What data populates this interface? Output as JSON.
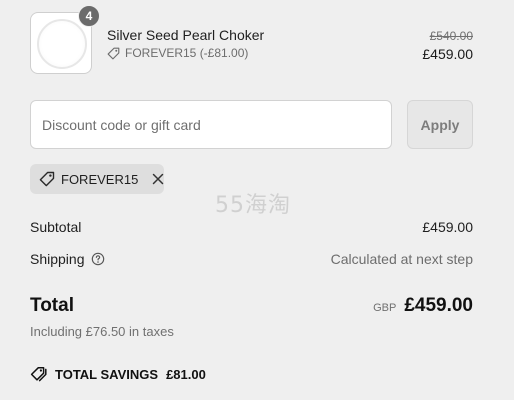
{
  "product": {
    "quantity": "4",
    "name": "Silver Seed Pearl Choker",
    "discount_label": "FOREVER15 (-£81.00)",
    "original_price": "£540.00",
    "final_price": "£459.00"
  },
  "discount": {
    "placeholder": "Discount code or gift card",
    "apply_label": "Apply",
    "applied_code": "FOREVER15"
  },
  "watermark": "55海淘",
  "summary": {
    "subtotal_label": "Subtotal",
    "subtotal_value": "£459.00",
    "shipping_label": "Shipping",
    "shipping_value": "Calculated at next step",
    "total_label": "Total",
    "currency": "GBP",
    "total_value": "£459.00",
    "tax_note": "Including £76.50 in taxes",
    "savings_label": "TOTAL SAVINGS",
    "savings_value": "£81.00"
  },
  "icons": {
    "tag": "tag-icon",
    "close": "close-icon",
    "help": "help-circle-icon",
    "savings_tag": "double-tag-icon"
  },
  "colors": {
    "background": "#efefef",
    "text": "#1a1a1a",
    "muted": "#707070",
    "chip": "#dedede",
    "badge": "#6b6b6b"
  }
}
